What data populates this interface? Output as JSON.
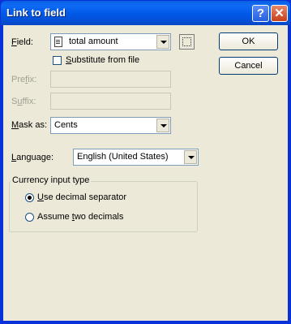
{
  "window": {
    "title": "Link to field"
  },
  "title_buttons": {
    "help": "?",
    "close": "✕"
  },
  "field": {
    "label_u": "F",
    "label_rest": "ield:",
    "value": "total amount",
    "icon": "document-icon"
  },
  "substitute": {
    "label_u": "S",
    "label_rest": "ubstitute from file",
    "checked": false
  },
  "prefix": {
    "label_a": "Pre",
    "label_u": "f",
    "label_b": "ix:",
    "value": ""
  },
  "suffix": {
    "label_a": "S",
    "label_u": "u",
    "label_b": "ffix:",
    "value": ""
  },
  "mask": {
    "label_u": "M",
    "label_rest": "ask as:",
    "value": "Cents"
  },
  "language": {
    "label_u": "L",
    "label_rest": "anguage:",
    "value": "English (United States)"
  },
  "currency": {
    "title": "Currency input type",
    "option1": {
      "label_u": "U",
      "label_rest": "se decimal separator",
      "selected": true
    },
    "option2": {
      "label_a": "Assume ",
      "label_u": "t",
      "label_b": "wo decimals",
      "selected": false
    }
  },
  "buttons": {
    "ok": "OK",
    "cancel": "Cancel"
  }
}
